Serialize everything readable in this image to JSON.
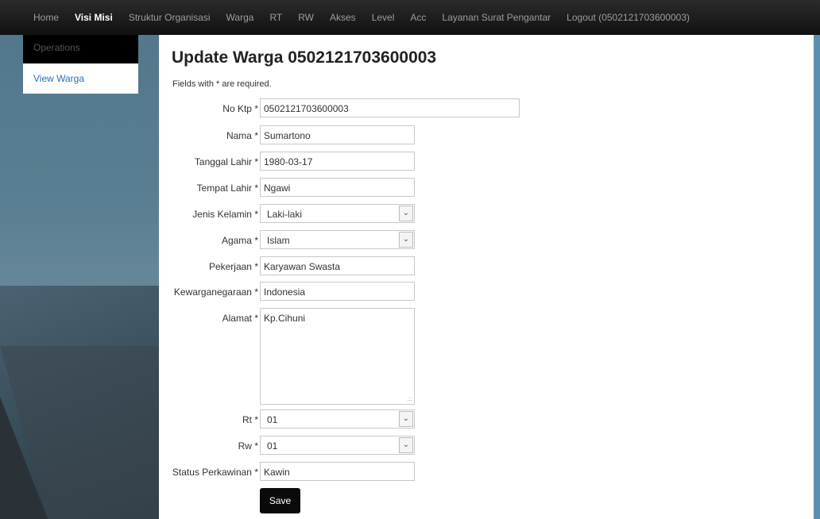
{
  "nav": {
    "items": [
      "Home",
      "Visi Misi",
      "Struktur Organisasi",
      "Warga",
      "RT",
      "RW",
      "Akses",
      "Level",
      "Acc",
      "Layanan Surat Pengantar",
      "Logout (0502121703600003)"
    ],
    "active": "Visi Misi"
  },
  "sidebar": {
    "heading": "Operations",
    "items": [
      {
        "label": "View Warga"
      }
    ]
  },
  "page": {
    "title": "Update Warga 0502121703600003",
    "required_note": "Fields with * are required."
  },
  "form": {
    "no_ktp": {
      "label": "No Ktp",
      "value": "0502121703600003"
    },
    "nama": {
      "label": "Nama",
      "value": "Sumartono"
    },
    "tanggal_lahir": {
      "label": "Tanggal Lahir",
      "value": "1980-03-17"
    },
    "tempat_lahir": {
      "label": "Tempat Lahir",
      "value": "Ngawi"
    },
    "jenis_kelamin": {
      "label": "Jenis Kelamin",
      "value": "Laki-laki"
    },
    "agama": {
      "label": "Agama",
      "value": "Islam"
    },
    "pekerjaan": {
      "label": "Pekerjaan",
      "value": "Karyawan Swasta"
    },
    "kewarganegaraan": {
      "label": "Kewarganegaraan",
      "value": "Indonesia"
    },
    "alamat": {
      "label": "Alamat",
      "value": "Kp.Cihuni"
    },
    "rt": {
      "label": "Rt",
      "value": "01"
    },
    "rw": {
      "label": "Rw",
      "value": "01"
    },
    "status_perkawinan": {
      "label": "Status Perkawinan",
      "value": "Kawin"
    },
    "required_marker": "*",
    "save_label": "Save"
  },
  "icons": {
    "select_arrow": "chevron-down-icon",
    "resize": "resize-grip-icon"
  }
}
